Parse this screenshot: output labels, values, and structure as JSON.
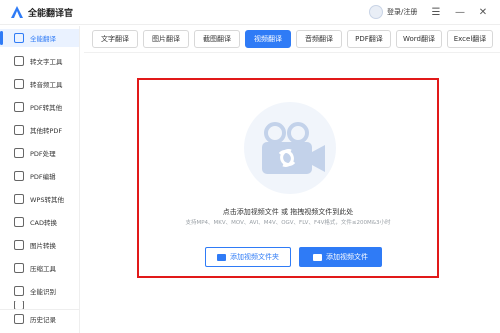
{
  "app": {
    "title": "全能翻译官",
    "login_text": "登录/注册"
  },
  "window_controls": {
    "menu_icon": "hamburger-icon",
    "minimize_icon": "minimize-icon",
    "close_icon": "close-icon"
  },
  "sidebar": {
    "items": [
      {
        "label": "全能翻译",
        "icon": "translate-icon"
      },
      {
        "label": "转文字工具",
        "icon": "text-tool-icon"
      },
      {
        "label": "转音频工具",
        "icon": "audio-tool-icon"
      },
      {
        "label": "PDF转其他",
        "icon": "pdf-convert-icon"
      },
      {
        "label": "其他转PDF",
        "icon": "to-pdf-icon"
      },
      {
        "label": "PDF处理",
        "icon": "pdf-process-icon"
      },
      {
        "label": "PDF编辑",
        "icon": "pdf-edit-icon"
      },
      {
        "label": "WPS转其他",
        "icon": "wps-icon"
      },
      {
        "label": "CAD转换",
        "icon": "cad-icon"
      },
      {
        "label": "图片转换",
        "icon": "image-icon"
      },
      {
        "label": "压缩工具",
        "icon": "compress-icon"
      },
      {
        "label": "全能识别",
        "icon": "recognize-icon"
      },
      {
        "label": "",
        "icon": "more-icon"
      },
      {
        "label": "历史记录",
        "icon": "history-icon"
      }
    ]
  },
  "tabs": [
    {
      "label": "文字翻译"
    },
    {
      "label": "图片翻译"
    },
    {
      "label": "截图翻译"
    },
    {
      "label": "视频翻译"
    },
    {
      "label": "音频翻译"
    },
    {
      "label": "PDF翻译"
    },
    {
      "label": "Word翻译"
    },
    {
      "label": "Excel翻译"
    }
  ],
  "upload": {
    "hint_main": "点击添加视频文件 或 拖拽视频文件到此处",
    "hint_formats": "支持MP4、MKV、MOV、AVI、M4V、OGV、FLV、F4V格式，文件≤200M&3小时",
    "add_folder_label": "添加视频文件夹",
    "add_file_label": "添加视频文件"
  },
  "colors": {
    "accent": "#2f7bf6",
    "highlight_border": "#e11919"
  }
}
